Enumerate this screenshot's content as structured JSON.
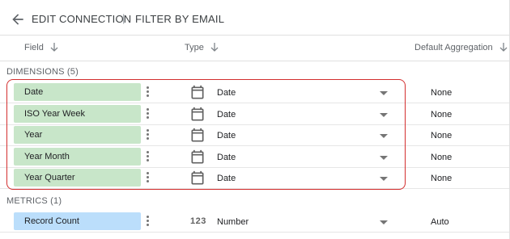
{
  "header": {
    "breadcrumb_1": "EDIT CONNECTION",
    "separator": "|",
    "breadcrumb_2": "FILTER BY EMAIL"
  },
  "columns": {
    "field": "Field",
    "type": "Type",
    "aggregation": "Default Aggregation"
  },
  "dimensions": {
    "label": "DIMENSIONS (5)",
    "rows": [
      {
        "name": "Date",
        "type_icon": "calendar-icon",
        "type": "Date",
        "aggregation": "None"
      },
      {
        "name": "ISO Year Week",
        "type_icon": "calendar-icon",
        "type": "Date",
        "aggregation": "None"
      },
      {
        "name": "Year",
        "type_icon": "calendar-icon",
        "type": "Date",
        "aggregation": "None"
      },
      {
        "name": "Year Month",
        "type_icon": "calendar-icon",
        "type": "Date",
        "aggregation": "None"
      },
      {
        "name": "Year Quarter",
        "type_icon": "calendar-icon",
        "type": "Date",
        "aggregation": "None"
      }
    ]
  },
  "metrics": {
    "label": "METRICS (1)",
    "rows": [
      {
        "name": "Record Count",
        "type_icon_text": "123",
        "type": "Number",
        "aggregation": "Auto"
      }
    ]
  },
  "colors": {
    "dimension_chip": "#c8e6c9",
    "metric_chip": "#bbdefb",
    "highlight_border": "#d32f2f"
  }
}
